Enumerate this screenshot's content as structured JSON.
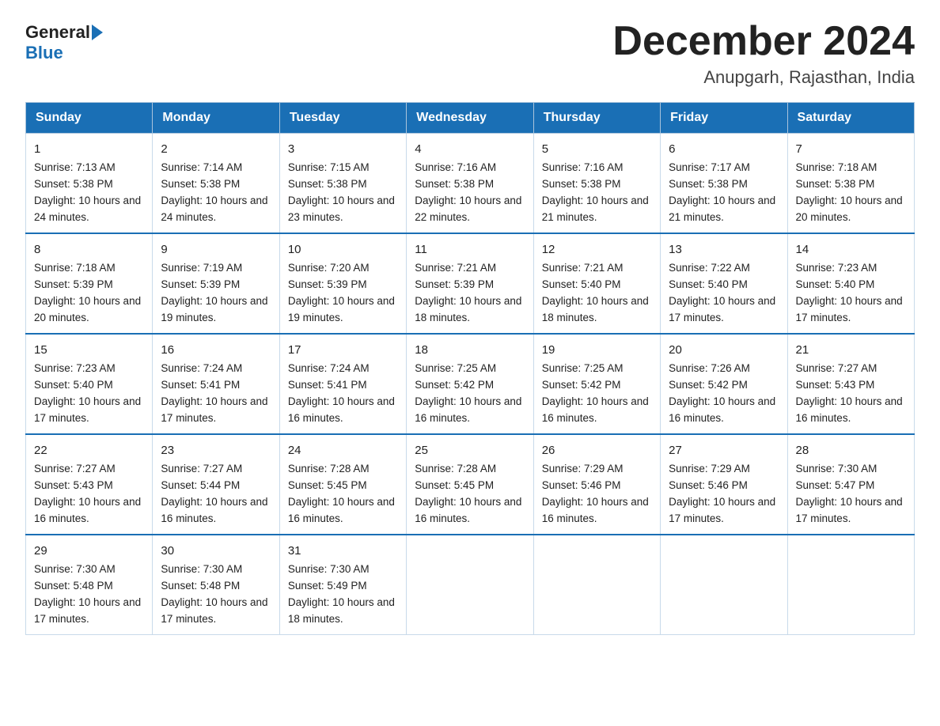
{
  "logo": {
    "general_text": "General",
    "blue_text": "Blue"
  },
  "title": "December 2024",
  "subtitle": "Anupgarh, Rajasthan, India",
  "days_of_week": [
    "Sunday",
    "Monday",
    "Tuesday",
    "Wednesday",
    "Thursday",
    "Friday",
    "Saturday"
  ],
  "weeks": [
    [
      {
        "day": 1,
        "sunrise": "7:13 AM",
        "sunset": "5:38 PM",
        "daylight": "10 hours and 24 minutes."
      },
      {
        "day": 2,
        "sunrise": "7:14 AM",
        "sunset": "5:38 PM",
        "daylight": "10 hours and 24 minutes."
      },
      {
        "day": 3,
        "sunrise": "7:15 AM",
        "sunset": "5:38 PM",
        "daylight": "10 hours and 23 minutes."
      },
      {
        "day": 4,
        "sunrise": "7:16 AM",
        "sunset": "5:38 PM",
        "daylight": "10 hours and 22 minutes."
      },
      {
        "day": 5,
        "sunrise": "7:16 AM",
        "sunset": "5:38 PM",
        "daylight": "10 hours and 21 minutes."
      },
      {
        "day": 6,
        "sunrise": "7:17 AM",
        "sunset": "5:38 PM",
        "daylight": "10 hours and 21 minutes."
      },
      {
        "day": 7,
        "sunrise": "7:18 AM",
        "sunset": "5:38 PM",
        "daylight": "10 hours and 20 minutes."
      }
    ],
    [
      {
        "day": 8,
        "sunrise": "7:18 AM",
        "sunset": "5:39 PM",
        "daylight": "10 hours and 20 minutes."
      },
      {
        "day": 9,
        "sunrise": "7:19 AM",
        "sunset": "5:39 PM",
        "daylight": "10 hours and 19 minutes."
      },
      {
        "day": 10,
        "sunrise": "7:20 AM",
        "sunset": "5:39 PM",
        "daylight": "10 hours and 19 minutes."
      },
      {
        "day": 11,
        "sunrise": "7:21 AM",
        "sunset": "5:39 PM",
        "daylight": "10 hours and 18 minutes."
      },
      {
        "day": 12,
        "sunrise": "7:21 AM",
        "sunset": "5:40 PM",
        "daylight": "10 hours and 18 minutes."
      },
      {
        "day": 13,
        "sunrise": "7:22 AM",
        "sunset": "5:40 PM",
        "daylight": "10 hours and 17 minutes."
      },
      {
        "day": 14,
        "sunrise": "7:23 AM",
        "sunset": "5:40 PM",
        "daylight": "10 hours and 17 minutes."
      }
    ],
    [
      {
        "day": 15,
        "sunrise": "7:23 AM",
        "sunset": "5:40 PM",
        "daylight": "10 hours and 17 minutes."
      },
      {
        "day": 16,
        "sunrise": "7:24 AM",
        "sunset": "5:41 PM",
        "daylight": "10 hours and 17 minutes."
      },
      {
        "day": 17,
        "sunrise": "7:24 AM",
        "sunset": "5:41 PM",
        "daylight": "10 hours and 16 minutes."
      },
      {
        "day": 18,
        "sunrise": "7:25 AM",
        "sunset": "5:42 PM",
        "daylight": "10 hours and 16 minutes."
      },
      {
        "day": 19,
        "sunrise": "7:25 AM",
        "sunset": "5:42 PM",
        "daylight": "10 hours and 16 minutes."
      },
      {
        "day": 20,
        "sunrise": "7:26 AM",
        "sunset": "5:42 PM",
        "daylight": "10 hours and 16 minutes."
      },
      {
        "day": 21,
        "sunrise": "7:27 AM",
        "sunset": "5:43 PM",
        "daylight": "10 hours and 16 minutes."
      }
    ],
    [
      {
        "day": 22,
        "sunrise": "7:27 AM",
        "sunset": "5:43 PM",
        "daylight": "10 hours and 16 minutes."
      },
      {
        "day": 23,
        "sunrise": "7:27 AM",
        "sunset": "5:44 PM",
        "daylight": "10 hours and 16 minutes."
      },
      {
        "day": 24,
        "sunrise": "7:28 AM",
        "sunset": "5:45 PM",
        "daylight": "10 hours and 16 minutes."
      },
      {
        "day": 25,
        "sunrise": "7:28 AM",
        "sunset": "5:45 PM",
        "daylight": "10 hours and 16 minutes."
      },
      {
        "day": 26,
        "sunrise": "7:29 AM",
        "sunset": "5:46 PM",
        "daylight": "10 hours and 16 minutes."
      },
      {
        "day": 27,
        "sunrise": "7:29 AM",
        "sunset": "5:46 PM",
        "daylight": "10 hours and 17 minutes."
      },
      {
        "day": 28,
        "sunrise": "7:30 AM",
        "sunset": "5:47 PM",
        "daylight": "10 hours and 17 minutes."
      }
    ],
    [
      {
        "day": 29,
        "sunrise": "7:30 AM",
        "sunset": "5:48 PM",
        "daylight": "10 hours and 17 minutes."
      },
      {
        "day": 30,
        "sunrise": "7:30 AM",
        "sunset": "5:48 PM",
        "daylight": "10 hours and 17 minutes."
      },
      {
        "day": 31,
        "sunrise": "7:30 AM",
        "sunset": "5:49 PM",
        "daylight": "10 hours and 18 minutes."
      },
      null,
      null,
      null,
      null
    ]
  ]
}
